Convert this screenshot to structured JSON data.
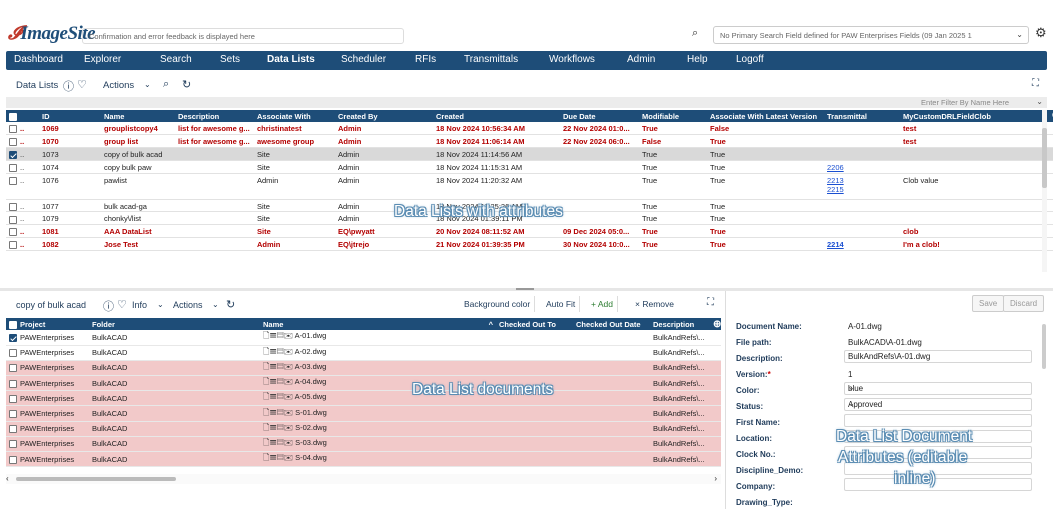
{
  "app": {
    "logo_prefix": "",
    "logo": "ImageSite",
    "message": "Confirmation and error feedback is displayed here",
    "search_placeholder": "No Primary Search Field defined for PAW Enterprises Fields (09 Jan 2025 1"
  },
  "nav": [
    "Dashboard",
    "Explorer",
    "Search",
    "Sets",
    "Data Lists",
    "Scheduler",
    "RFIs",
    "Transmittals",
    "Workflows",
    "Admin",
    "Help",
    "Logoff"
  ],
  "data_lists": {
    "title": "Data Lists",
    "actions_label": "Actions",
    "filter_placeholder": "Enter Filter By Name Here",
    "columns": [
      "ID",
      "Name",
      "Description",
      "Associate With",
      "Created By",
      "Created",
      "Due Date",
      "Modifiable",
      "Associate With Latest Version",
      "Transmittal",
      "MyCustomDRLFieldClob"
    ],
    "rows": [
      {
        "id": "1069",
        "name": "grouplistcopy4",
        "desc": "list for awesome g...",
        "assoc": "christinatest",
        "by": "Admin",
        "created": "18 Nov 2024 10:56:34 AM",
        "due": "22 Nov 2024 01:0...",
        "mod": "True",
        "latest": "False",
        "trans": "",
        "trans2": "",
        "clob": "test",
        "red": true,
        "checked": false
      },
      {
        "id": "1070",
        "name": "group list",
        "desc": "list for awesome g...",
        "assoc": "awesome group",
        "by": "Admin",
        "created": "18 Nov 2024 11:06:14 AM",
        "due": "22 Nov 2024 06:0...",
        "mod": "False",
        "latest": "True",
        "trans": "",
        "trans2": "",
        "clob": "test",
        "red": true,
        "checked": false
      },
      {
        "id": "1073",
        "name": "copy of bulk acad",
        "desc": "",
        "assoc": "Site",
        "by": "Admin",
        "created": "18 Nov 2024 11:14:56 AM",
        "due": "",
        "mod": "True",
        "latest": "True",
        "trans": "",
        "trans2": "",
        "clob": "",
        "red": false,
        "checked": true
      },
      {
        "id": "1074",
        "name": "copy bulk paw",
        "desc": "",
        "assoc": "Site",
        "by": "Admin",
        "created": "18 Nov 2024 11:15:31 AM",
        "due": "",
        "mod": "True",
        "latest": "True",
        "trans": "2206",
        "trans2": "",
        "clob": "",
        "red": false,
        "checked": false
      },
      {
        "id": "1076",
        "name": "pawlist",
        "desc": "",
        "assoc": "Admin",
        "by": "Admin",
        "created": "18 Nov 2024 11:20:32 AM",
        "due": "",
        "mod": "True",
        "latest": "True",
        "trans": "2213",
        "trans2": "2215",
        "clob": "Clob value",
        "red": false,
        "checked": false
      },
      {
        "id": "1077",
        "name": "bulk acad-ga",
        "desc": "",
        "assoc": "Site",
        "by": "Admin",
        "created": "18 Nov 2024 11:25:26 AM",
        "due": "",
        "mod": "True",
        "latest": "True",
        "trans": "",
        "trans2": "",
        "clob": "",
        "red": false,
        "checked": false
      },
      {
        "id": "1079",
        "name": "chonky\\/list",
        "desc": "",
        "assoc": "Site",
        "by": "Admin",
        "created": "18 Nov 2024 01:39:11 PM",
        "due": "",
        "mod": "True",
        "latest": "True",
        "trans": "",
        "trans2": "",
        "clob": "",
        "red": false,
        "checked": false
      },
      {
        "id": "1081",
        "name": "AAA DataList",
        "desc": "",
        "assoc": "Site",
        "by": "EQ\\pwyatt",
        "created": "20 Nov 2024 08:11:52 AM",
        "due": "09 Dec 2024 05:0...",
        "mod": "True",
        "latest": "True",
        "trans": "",
        "trans2": "",
        "clob": "clob",
        "red": true,
        "checked": false
      },
      {
        "id": "1082",
        "name": "Jose Test",
        "desc": "",
        "assoc": "Admin",
        "by": "EQ\\jtrejo",
        "created": "21 Nov 2024 01:39:35 PM",
        "due": "30 Nov 2024 10:0...",
        "mod": "True",
        "latest": "True",
        "trans": "2214",
        "trans2": "",
        "clob": "I'm a clob!",
        "red": true,
        "checked": false
      }
    ]
  },
  "overlay1": "Data Lists with attributes",
  "overlay2": "Data List documents",
  "overlay3_line1": "Data List Document",
  "overlay3_line2": "Attributes (editable",
  "overlay3_line3": "inline)",
  "docs": {
    "title": "copy of bulk acad",
    "info_label": "Info",
    "actions_label": "Actions",
    "bg_color": "Background color",
    "auto_fit": "Auto Fit",
    "add": "+ Add",
    "remove": "× Remove",
    "columns": [
      "Project",
      "Folder",
      "Name",
      "Checked Out To",
      "Checked Out Date",
      "Description"
    ],
    "rows": [
      {
        "project": "PAWEnterprises",
        "folder": "BulkACAD",
        "name": "A-01.dwg",
        "desc": "BulkAndRefs\\...",
        "pink": false,
        "checked": true
      },
      {
        "project": "PAWEnterprises",
        "folder": "BulkACAD",
        "name": "A-02.dwg",
        "desc": "BulkAndRefs\\...",
        "pink": false,
        "checked": false
      },
      {
        "project": "PAWEnterprises",
        "folder": "BulkACAD",
        "name": "A-03.dwg",
        "desc": "BulkAndRefs\\...",
        "pink": true,
        "checked": false
      },
      {
        "project": "PAWEnterprises",
        "folder": "BulkACAD",
        "name": "A-04.dwg",
        "desc": "BulkAndRefs\\...",
        "pink": true,
        "checked": false
      },
      {
        "project": "PAWEnterprises",
        "folder": "BulkACAD",
        "name": "A-05.dwg",
        "desc": "BulkAndRefs\\...",
        "pink": true,
        "checked": false
      },
      {
        "project": "PAWEnterprises",
        "folder": "BulkACAD",
        "name": "S-01.dwg",
        "desc": "BulkAndRefs\\...",
        "pink": true,
        "checked": false
      },
      {
        "project": "PAWEnterprises",
        "folder": "BulkACAD",
        "name": "S-02.dwg",
        "desc": "BulkAndRefs\\...",
        "pink": true,
        "checked": false
      },
      {
        "project": "PAWEnterprises",
        "folder": "BulkACAD",
        "name": "S-03.dwg",
        "desc": "BulkAndRefs\\...",
        "pink": true,
        "checked": false
      },
      {
        "project": "PAWEnterprises",
        "folder": "BulkACAD",
        "name": "S-04.dwg",
        "desc": "BulkAndRefs\\...",
        "pink": true,
        "checked": false
      }
    ]
  },
  "attrs": {
    "save": "Save",
    "discard": "Discard",
    "doc_name_label": "Document Name:",
    "doc_name": "A-01.dwg",
    "file_path_label": "File path:",
    "file_path": "BulkACAD\\A-01.dwg",
    "description_label": "Description:",
    "description": "BulkAndRefs\\A-01.dwg",
    "version_label": "Version:",
    "version_req": "*",
    "version": "1",
    "color_label": "Color:",
    "color": "blue",
    "status_label": "Status:",
    "status": "Approved",
    "first_name_label": "First Name:",
    "location_label": "Location:",
    "clock_label": "Clock No.:",
    "discipline_label": "Discipline_Demo:",
    "company_label": "Company:",
    "drawing_type_label": "Drawing_Type:"
  }
}
